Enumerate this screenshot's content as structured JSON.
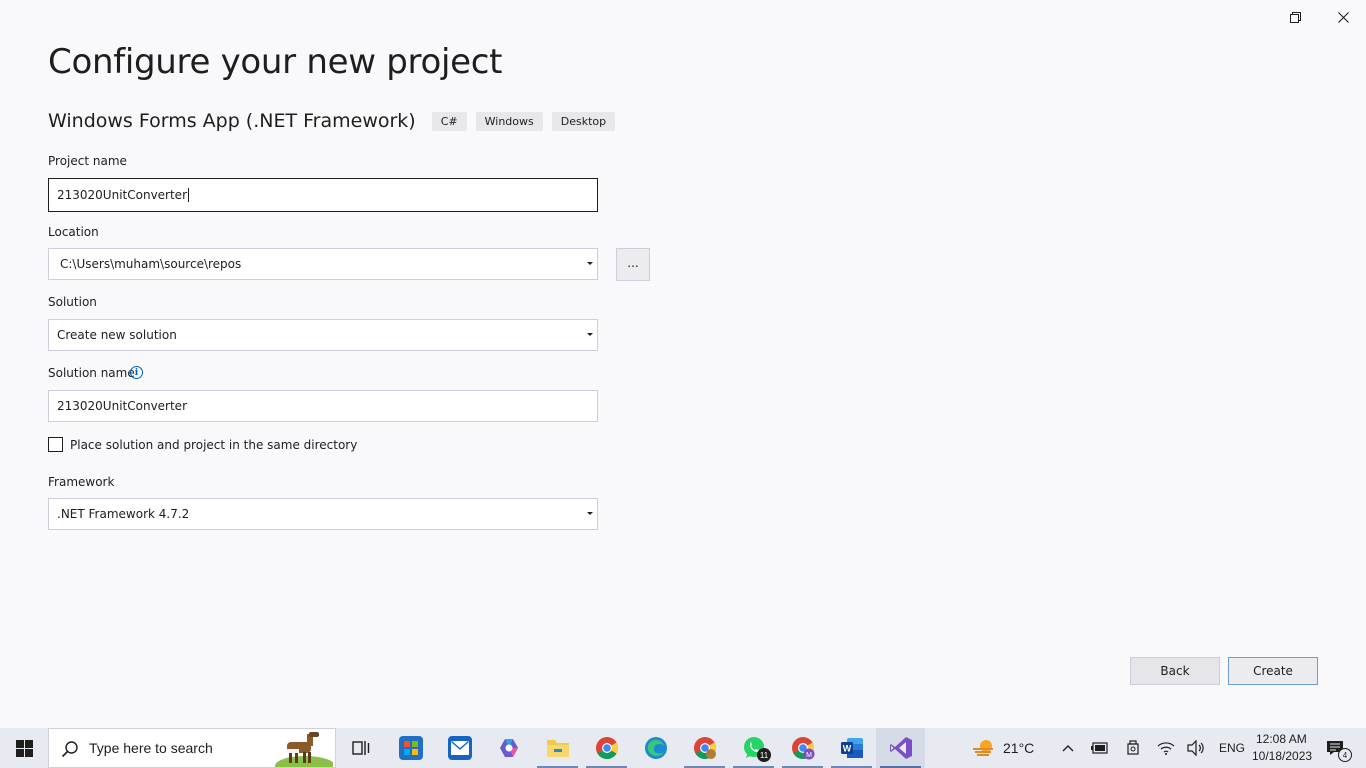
{
  "window": {
    "restore_icon": "restore-icon",
    "close_icon": "close-icon"
  },
  "page": {
    "title": "Configure your new project",
    "template_name": "Windows Forms App (.NET Framework)",
    "tags": [
      "C#",
      "Windows",
      "Desktop"
    ]
  },
  "form": {
    "project_name_label": "Project name",
    "project_name_value": "213020UnitConverter",
    "location_label": "Location",
    "location_value": "C:\\Users\\muham\\source\\repos",
    "browse_label": "...",
    "solution_label": "Solution",
    "solution_value": "Create new solution",
    "solution_name_label": "Solution name",
    "solution_name_value": "213020UnitConverter",
    "same_dir_label": "Place solution and project in the same directory",
    "same_dir_checked": false,
    "framework_label": "Framework",
    "framework_value": ".NET Framework 4.7.2"
  },
  "buttons": {
    "back": "Back",
    "create": "Create"
  },
  "taskbar": {
    "search_placeholder": "Type here to search",
    "apps": [
      {
        "name": "task-view-icon"
      },
      {
        "name": "microsoft-store-icon"
      },
      {
        "name": "mail-icon"
      },
      {
        "name": "copilot-icon"
      },
      {
        "name": "file-explorer-icon"
      },
      {
        "name": "chrome-icon"
      },
      {
        "name": "edge-icon"
      },
      {
        "name": "chrome-profile-icon"
      },
      {
        "name": "whatsapp-icon",
        "badge": "11"
      },
      {
        "name": "chrome-profile-m-icon"
      },
      {
        "name": "word-icon"
      },
      {
        "name": "visual-studio-icon"
      }
    ],
    "weather_temp": "21°C",
    "language": "ENG",
    "time": "12:08 AM",
    "date": "10/18/2023",
    "notification_count": "4"
  },
  "colors": {
    "accent": "#005fb8",
    "vs_purple": "#7b4fc4",
    "background": "#f9f9fb"
  }
}
